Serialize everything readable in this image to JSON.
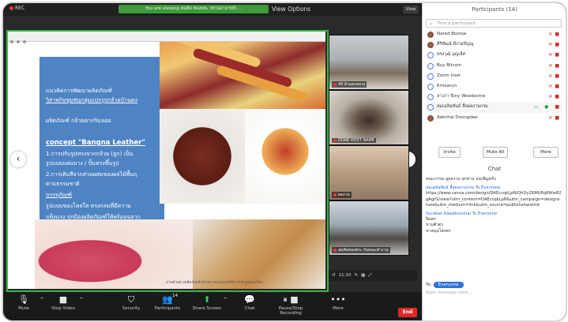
{
  "topbar": {
    "recording": "REC",
    "viewing_banner": "You are viewing สมคิด ทองพระ (ท่านอาจารย์) ...",
    "view_options": "View Options",
    "view_button": "View"
  },
  "slide": {
    "lines": [
      "แนวคิดการพัฒนาผลิตภัณฑ์",
      "วิสาหกิจชุมชนกลุ่มแปรรูปกล้วยบ้านคง",
      "ผลิตภัณฑ์ กล้วยตากริมลอย",
      "concept \"Bangna Leather\"",
      "1.การปรับรูปทรงจากกล้วย (ลูก) เป็น",
      "รูปแบบแผ่นบาง / ปั้นทรงขึ้นรูป",
      "2.การเติมสีจากส่วนผสมของผลไม้พื้นฤ",
      "ตามธรรมชาติ",
      "บรรจุภัณฑ์",
      "รูปแบบของโหลใส ทรงกลมที่มีความ",
      "แข็งแรง ปกป้องผลิตภัณฑ์ให้พร้อมฉลาก"
    ],
    "caption": "ภาพตัวอย่างผลิตภัณฑ์กล้วยตากแบบแผ่นที่มีการปรับรูปแบบใหม่"
  },
  "videos": [
    {
      "name": "49 ผ้าแดงหลวง"
    },
    {
      "name": "DOAE HOST NAME"
    },
    {
      "name": "ผลงาน"
    },
    {
      "name": "สมคิดทองพระ กับคณะทำงาน"
    }
  ],
  "mini_controls": {
    "label": "11:10"
  },
  "toolbar": {
    "buttons": [
      {
        "label": "Mute",
        "icon": "mic-icon"
      },
      {
        "label": "Stop Video",
        "icon": "video-icon"
      },
      {
        "label": "Security",
        "icon": "shield-icon"
      },
      {
        "label": "Participants",
        "icon": "people-icon",
        "count": "14"
      },
      {
        "label": "Share Screen",
        "icon": "share-icon"
      },
      {
        "label": "Chat",
        "icon": "chat-icon"
      },
      {
        "label": "Pause/Stop Recording",
        "icon": "record-icon"
      },
      {
        "label": "More",
        "icon": "more-icon"
      }
    ],
    "end_label": "End"
  },
  "participants": {
    "title": "Participants (14)",
    "search_placeholder": "Find a participant",
    "list": [
      {
        "name": "Nared Boonja"
      },
      {
        "name": "ศิริพัฒน์ ดีงามปัญญ"
      },
      {
        "name": "ทรงวุฒิ บุญเลิศ"
      },
      {
        "name": "Buy Bitcoin"
      },
      {
        "name": "Zoom User"
      },
      {
        "name": "Kritsarun"
      },
      {
        "name": "ลาเภา Tony Woodsome"
      },
      {
        "name": "สมเฉลิมพันธ์ สื่อผลงานกรม"
      },
      {
        "name": "Aekchai Doongdee"
      }
    ],
    "invite": "Invite",
    "mute_all": "Mute All",
    "more": "More"
  },
  "chat": {
    "title": "Chat",
    "messages": [
      {
        "from": "",
        "to": "",
        "body": "คณะกรรม ดูผลงาน ทุกท่าน ขอเชิญครับ"
      },
      {
        "from": "สมเฉลิมพันธ์ สื่อผลงานกรม",
        "to": "Everyone",
        "body": "https://www.canva.com/design/DAEccqkLpN/QhDy2RMU6qRWw82gAgrG/view?utm_content=DAEccqkLpN&utm_campaign=designshare&utm_medium=link&utm_source=publishsharelink"
      },
      {
        "from": "Surakan Kaewkunchai",
        "to": "Everyone",
        "body": "ปิดตร\nขามตัวตร\nขาสมุนไพรตร"
      }
    ],
    "to_label": "To:",
    "to_value": "Everyone",
    "input_placeholder": "Type message here..."
  }
}
